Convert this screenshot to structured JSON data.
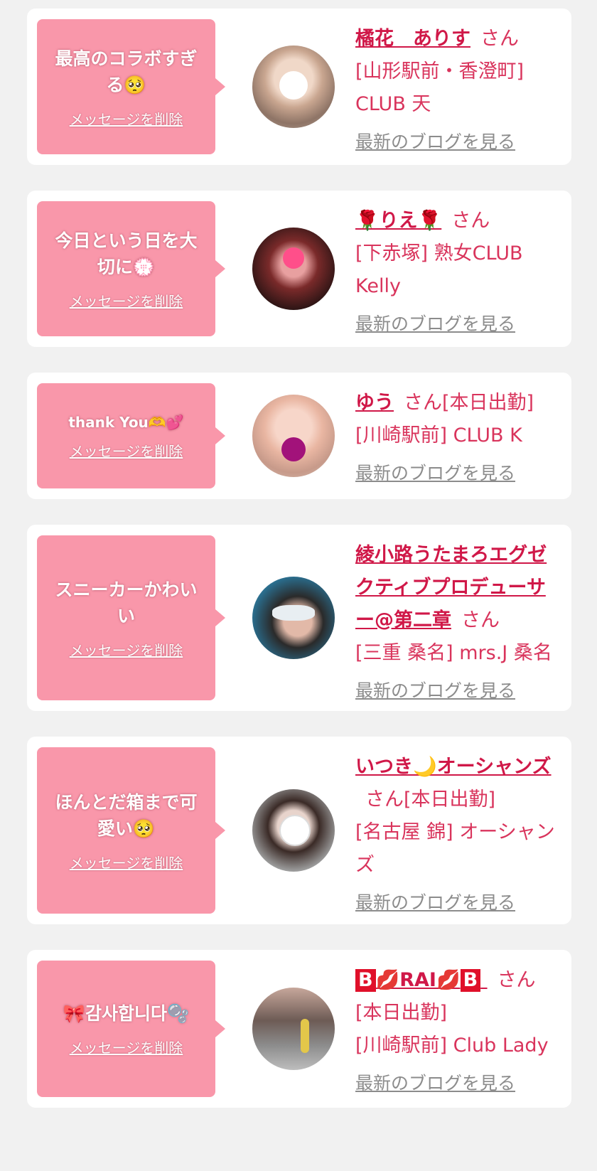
{
  "cards": [
    {
      "message": "最高のコラボすぎる🥺",
      "delete_label": "メッセージを削除",
      "name": "橘花　ありす",
      "honorific": "さん",
      "shop": "[山形駅前・香澄町] CLUB 天",
      "blog_label": "最新のブログを見る"
    },
    {
      "message": "今日という日を大切に💮",
      "delete_label": "メッセージを削除",
      "name": "🌹りえ🌹",
      "honorific": "さん",
      "shop": "[下赤塚] 熟女CLUB Kelly",
      "blog_label": "最新のブログを見る"
    },
    {
      "message": "thank You🫶💕",
      "delete_label": "メッセージを削除",
      "name": "ゆう",
      "honorific": "さん[本日出勤]",
      "shop": "[川崎駅前] CLUB K",
      "blog_label": "最新のブログを見る"
    },
    {
      "message": "スニーカーかわいい",
      "delete_label": "メッセージを削除",
      "name": "綾小路うたまろエグゼクティブプロデューサー@第二章",
      "honorific": "さん",
      "shop": "[三重 桑名] mrs.J 桑名",
      "blog_label": "最新のブログを見る"
    },
    {
      "message": "ほんとだ箱まで可愛い🥺",
      "delete_label": "メッセージを削除",
      "name": "いつき🌙オーシャンズ",
      "honorific": "さん[本日出勤]",
      "shop": "[名古屋 錦] オーシャンズ",
      "blog_label": "最新のブログを見る"
    },
    {
      "message": "🎀감사합니다🫧",
      "delete_label": "メッセージを削除",
      "name_parts": [
        "B",
        "💋RAI💋",
        "B"
      ],
      "honorific": "さん",
      "status": "[本日出勤]",
      "shop": "[川崎駅前] Club Lady",
      "blog_label": "最新のブログを見る"
    }
  ],
  "colors": {
    "bubble": "#f997aa",
    "name": "#d01848",
    "text": "#d9345c",
    "blog": "#8c8c8c",
    "background": "#f1f1f1"
  }
}
